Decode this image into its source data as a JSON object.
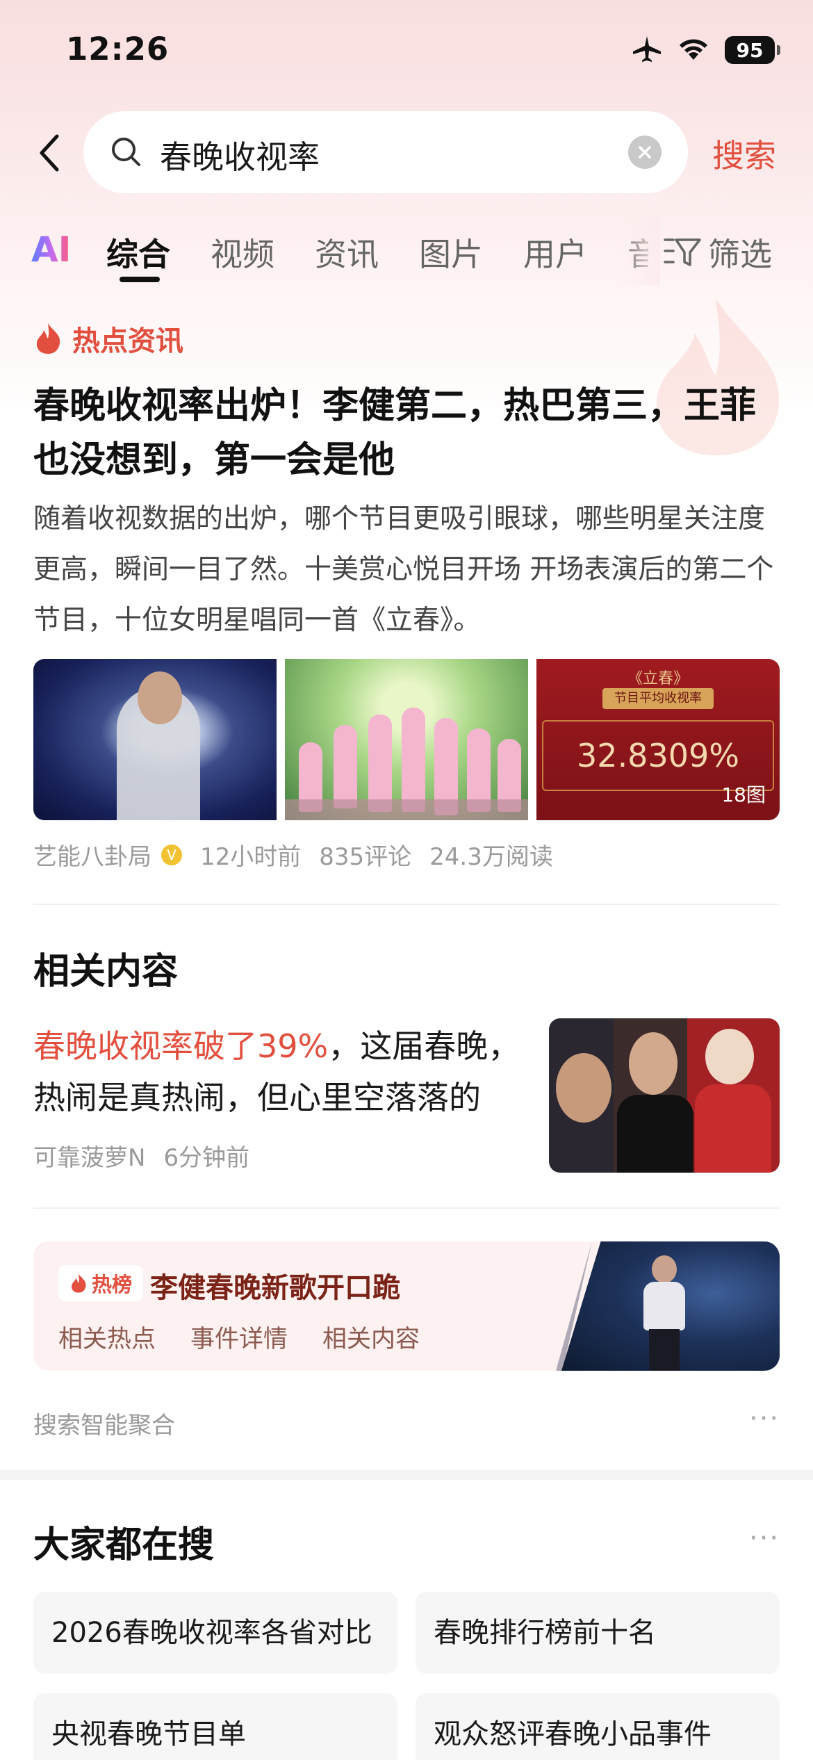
{
  "status_bar": {
    "time": "12:26",
    "battery": "95",
    "icons": [
      "airplane-icon",
      "wifi-icon",
      "battery-icon"
    ]
  },
  "search": {
    "query": "春晚收视率",
    "button_label": "搜索"
  },
  "tabs": {
    "ai_label": "AI",
    "items": [
      "综合",
      "视频",
      "资讯",
      "图片",
      "用户",
      "音"
    ],
    "active": "综合",
    "filter_label": "筛选"
  },
  "hot_news": {
    "section_label": "热点资讯",
    "title": "春晚收视率出炉！李健第二，热巴第三，王菲也没想到，第一会是他",
    "summary": "随着收视数据的出炉，哪个节目更吸引眼球，哪些明星关注度更高，瞬间一目了然。十美赏心悦目开场 开场表演后的第二个节目，十位女明星唱同一首《立春》。",
    "image3_title": "《立春》",
    "image3_tag": "节目平均收视率",
    "image3_value": "32.8309%",
    "image_count": "18图",
    "author": "艺能八卦局",
    "time_ago": "12小时前",
    "comments": "835评论",
    "reads": "24.3万阅读"
  },
  "related": {
    "section_title": "相关内容",
    "highlight": "春晚收视率破了39%",
    "rest": "，这届春晚，热闹是真热闹，但心里空落落的",
    "author": "可靠菠萝N",
    "time_ago": "6分钟前"
  },
  "hot_list": {
    "badge": "热榜",
    "title": "李健春晚新歌开口跪",
    "links": [
      "相关热点",
      "事件详情",
      "相关内容"
    ]
  },
  "aggregation_label": "搜索智能聚合",
  "popular": {
    "section_title": "大家都在搜",
    "items": [
      "2026春晚收视率各省对比",
      "春晚排行榜前十名",
      "央视春晚节目单",
      "观众怒评春晚小品事件"
    ]
  },
  "colors": {
    "accent": "#e24f3f",
    "header_bg": "#f9dedf"
  }
}
